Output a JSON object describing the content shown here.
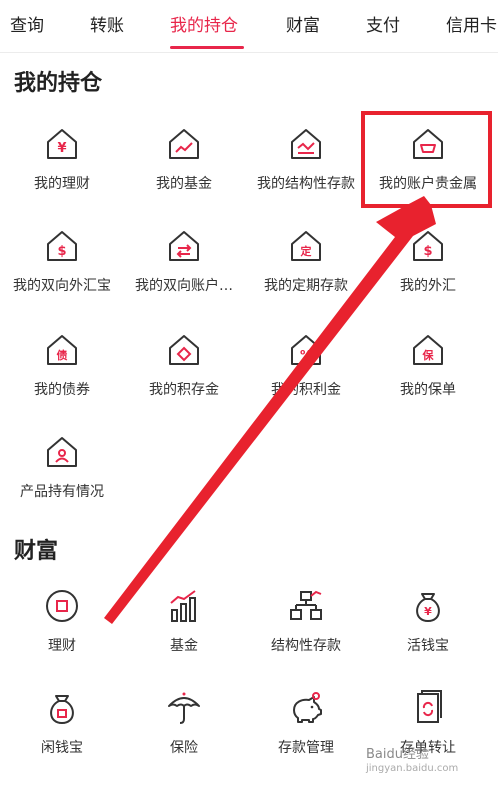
{
  "tabs": [
    {
      "label": "查询"
    },
    {
      "label": "转账"
    },
    {
      "label": "我的持仓"
    },
    {
      "label": "财富"
    },
    {
      "label": "支付"
    },
    {
      "label": "信用卡"
    }
  ],
  "holdings": {
    "title": "我的持仓",
    "items": [
      {
        "label": "我的理财",
        "glyph": "¥"
      },
      {
        "label": "我的基金",
        "glyph": "~"
      },
      {
        "label": "我的结构性存款",
        "glyph": "~"
      },
      {
        "label": "我的账户贵金属",
        "glyph": "o"
      },
      {
        "label": "我的双向外汇宝",
        "glyph": "$"
      },
      {
        "label": "我的双向账户…",
        "glyph": "⇄"
      },
      {
        "label": "我的定期存款",
        "glyph": "定"
      },
      {
        "label": "我的外汇",
        "glyph": "$"
      },
      {
        "label": "我的债券",
        "glyph": "债"
      },
      {
        "label": "我的积存金",
        "glyph": "◇"
      },
      {
        "label": "我的积利金",
        "glyph": "%"
      },
      {
        "label": "我的保单",
        "glyph": "保"
      },
      {
        "label": "产品持有情况",
        "glyph": "A"
      }
    ]
  },
  "wealth": {
    "title": "财富",
    "items": [
      {
        "label": "理财"
      },
      {
        "label": "基金"
      },
      {
        "label": "结构性存款"
      },
      {
        "label": "活钱宝"
      },
      {
        "label": "闲钱宝"
      },
      {
        "label": "保险"
      },
      {
        "label": "存款管理"
      },
      {
        "label": "存单转让"
      }
    ]
  },
  "colors": {
    "accent": "#e8264a",
    "annotation": "#e8222e",
    "icon_stroke": "#333333"
  },
  "watermark": {
    "line1": "Baidu经验",
    "line2": "jingyan.baidu.com"
  }
}
